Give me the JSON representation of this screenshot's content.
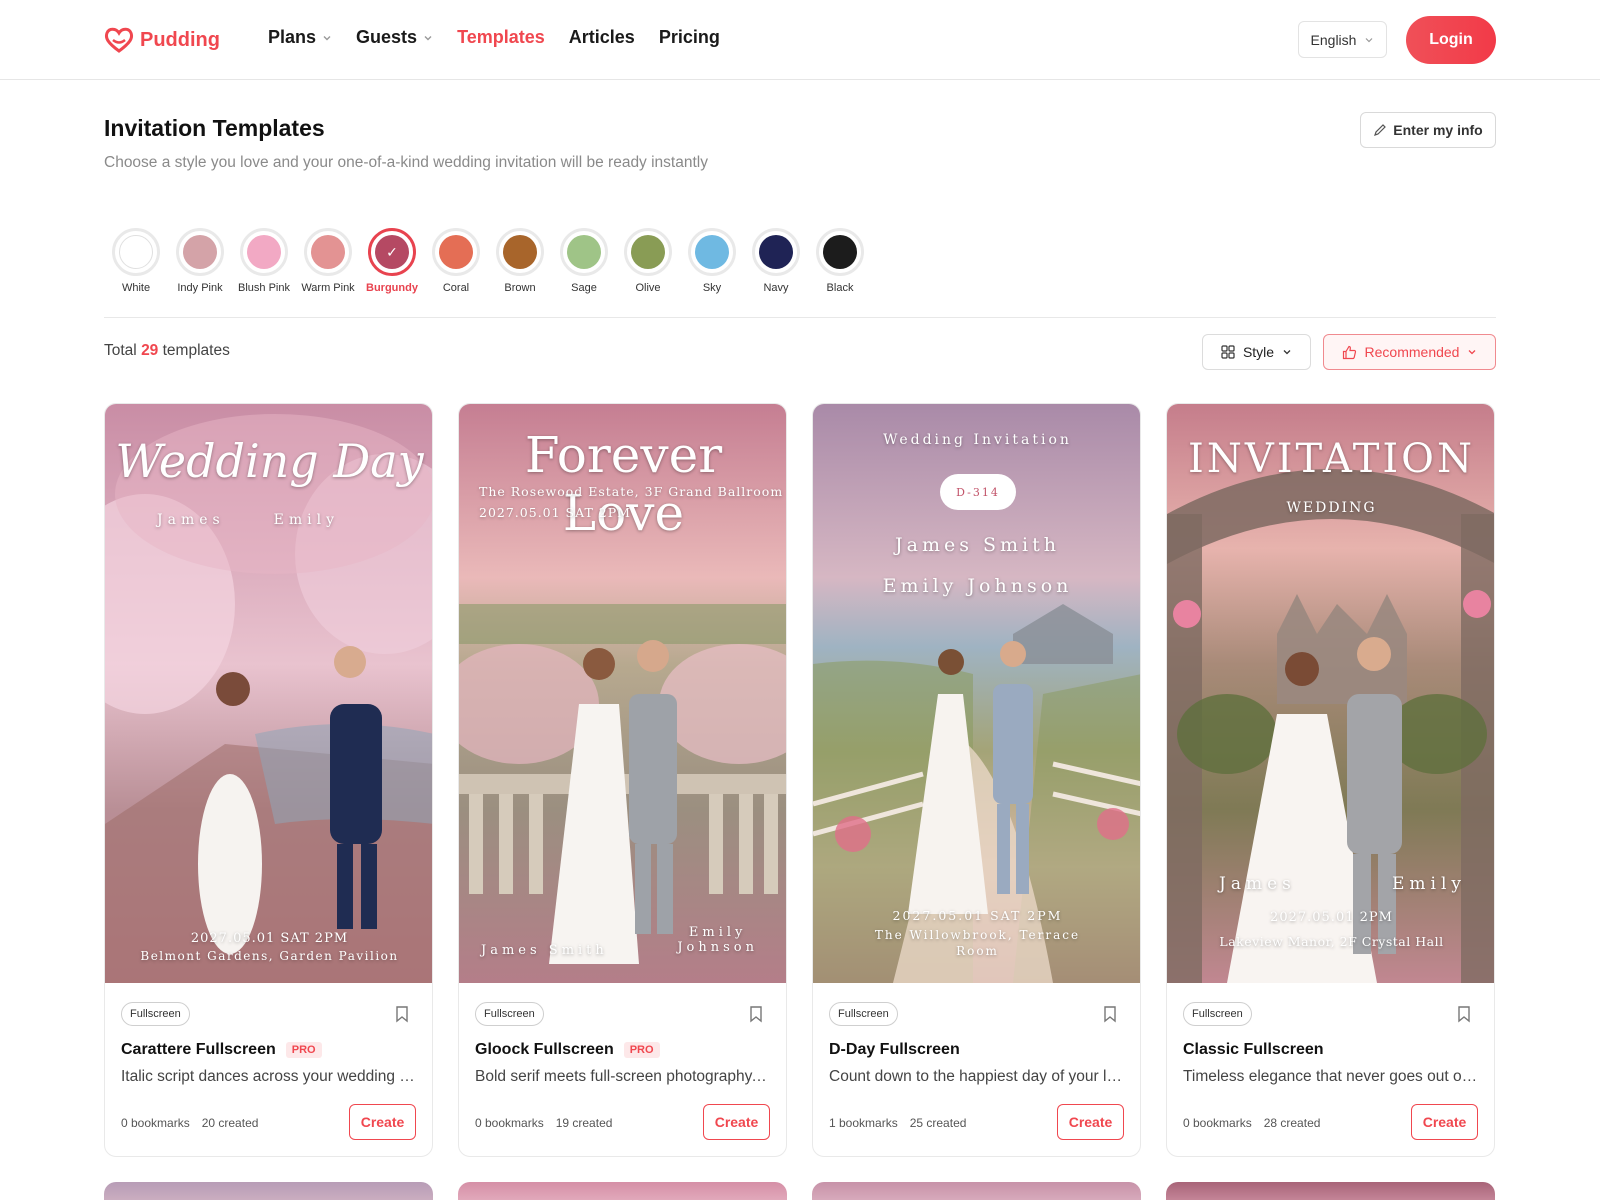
{
  "brand": {
    "name": "Pudding",
    "accent": "#f0474f"
  },
  "nav": [
    {
      "label": "Plans",
      "dropdown": true,
      "active": false
    },
    {
      "label": "Guests",
      "dropdown": true,
      "active": false
    },
    {
      "label": "Templates",
      "dropdown": false,
      "active": true
    },
    {
      "label": "Articles",
      "dropdown": false,
      "active": false
    },
    {
      "label": "Pricing",
      "dropdown": false,
      "active": false
    }
  ],
  "language": "English",
  "login_label": "Login",
  "page": {
    "title": "Invitation Templates",
    "subtitle": "Choose a style you love and your one-of-a-kind wedding invitation will be ready instantly",
    "enter_info": "Enter my info"
  },
  "colors": [
    {
      "label": "White",
      "hex": "#ffffff",
      "selected": false
    },
    {
      "label": "Indy Pink",
      "hex": "#d4a3a8",
      "selected": false
    },
    {
      "label": "Blush Pink",
      "hex": "#f2a9c4",
      "selected": false
    },
    {
      "label": "Warm Pink",
      "hex": "#e39393",
      "selected": false
    },
    {
      "label": "Burgundy",
      "hex": "#b54963",
      "selected": true
    },
    {
      "label": "Coral",
      "hex": "#e46e55",
      "selected": false
    },
    {
      "label": "Brown",
      "hex": "#a8652b",
      "selected": false
    },
    {
      "label": "Sage",
      "hex": "#9fc487",
      "selected": false
    },
    {
      "label": "Olive",
      "hex": "#899c55",
      "selected": false
    },
    {
      "label": "Sky",
      "hex": "#6fb9e2",
      "selected": false
    },
    {
      "label": "Navy",
      "hex": "#1f2355",
      "selected": false
    },
    {
      "label": "Black",
      "hex": "#1c1c1c",
      "selected": false
    }
  ],
  "listing": {
    "total_prefix": "Total",
    "total_count": "29",
    "total_suffix": "templates",
    "style_label": "Style",
    "sort_label": "Recommended"
  },
  "cards": [
    {
      "badge": "Fullscreen",
      "name": "Carattere Fullscreen",
      "pro": "PRO",
      "desc": "Italic script dances across your wedding photo",
      "bookmarks": "0 bookmarks",
      "created": "20 created",
      "cta": "Create",
      "overlay": {
        "headline": "Wedding Day",
        "groom": "James",
        "bride": "Emily",
        "date": "2027.05.01 SAT 2PM",
        "venue": "Belmont Gardens, Garden Pavilion"
      }
    },
    {
      "badge": "Fullscreen",
      "name": "Gloock Fullscreen",
      "pro": "PRO",
      "desc": "Bold serif meets full-screen photography. A classic choice",
      "bookmarks": "0 bookmarks",
      "created": "19 created",
      "cta": "Create",
      "overlay": {
        "headline": "Forever Love",
        "venue": "The Rosewood Estate, 3F Grand Ballroom",
        "date": "2027.05.01 SAT 2PM",
        "groom": "James Smith",
        "bride_first": "Emily",
        "bride_last": "Johnson"
      }
    },
    {
      "badge": "Fullscreen",
      "name": "D-Day Fullscreen",
      "pro": "",
      "desc": "Count down to the happiest day of your life together",
      "bookmarks": "1 bookmarks",
      "created": "25 created",
      "cta": "Create",
      "overlay": {
        "headline": "Wedding Invitation",
        "dday": "D-314",
        "groom": "James Smith",
        "bride": "Emily Johnson",
        "date": "2027.05.01 SAT 2PM",
        "venue1": "The Willowbrook, Terrace",
        "venue2": "Room"
      }
    },
    {
      "badge": "Fullscreen",
      "name": "Classic Fullscreen",
      "pro": "",
      "desc": "Timeless elegance that never goes out of style",
      "bookmarks": "0 bookmarks",
      "created": "28 created",
      "cta": "Create",
      "overlay": {
        "headline": "INVITATION",
        "sub": "WEDDING",
        "groom": "James",
        "bride": "Emily",
        "date": "2027.05.01 2PM",
        "venue": "Lakeview Manor, 2F Crystal Hall"
      }
    }
  ]
}
